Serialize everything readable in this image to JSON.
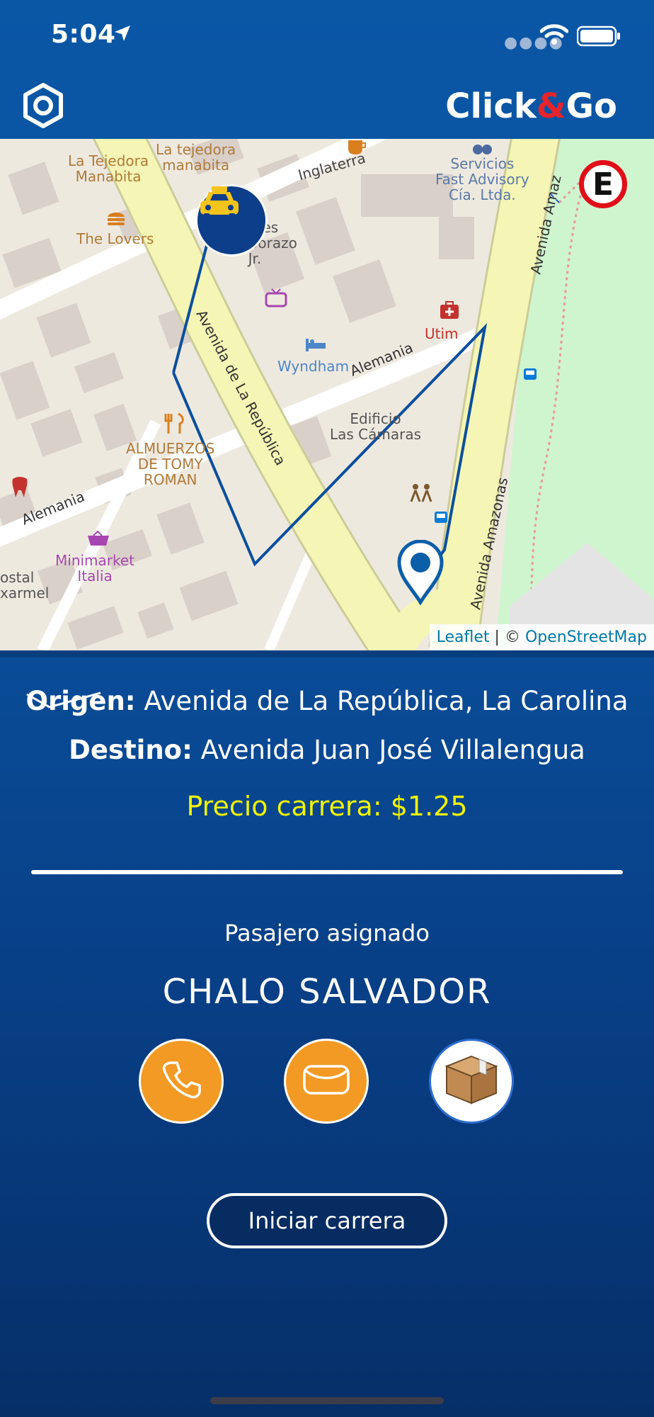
{
  "status_bar": {
    "time": "5:04"
  },
  "header": {
    "logo_prefix": "Click",
    "logo_amp": "&",
    "logo_suffix": "Go",
    "settings_icon": "hexagon-settings-icon"
  },
  "map": {
    "labels": {
      "tejedora": "La Tejedora\nManabita",
      "tejedora2": "La tejedora\nmanabita",
      "inglaterra": "Inglaterra",
      "servicios": "Servicios\nFast Advisory\nCía. Ltda.",
      "amazonas_top": "Avenida Amaz",
      "lovers": "The Lovers",
      "antenes": "tcenes\nChimborazo\nJr.",
      "utim": "Utim",
      "wyndham": "Wyndham",
      "alemania_mid": "Alemania",
      "republica": "Avenida de La República",
      "edificio": "Edificio\nLas Cámaras",
      "almuerzos": "ALMUERZOS\nDE TOMY\nROMAN",
      "alemania_left": "Alemania",
      "minimarket": "Minimarket\nItalia",
      "ostal": "ostal\nxarmel",
      "amazonas_bottom": "Avenida Amazonas",
      "parking": "E"
    },
    "attribution_leaflet": "Leaflet",
    "attribution_sep": " | © ",
    "attribution_osm": "OpenStreetMap"
  },
  "trip": {
    "origin_label": "Origen:",
    "origin_value": "Avenida de La República, La Carolina",
    "dest_label": "Destino:",
    "dest_value": "Avenida Juan José Villalengua",
    "price_label": "Precio carrera:",
    "price_value": "$1.25"
  },
  "passenger": {
    "label": "Pasajero asignado",
    "name": "CHALO SALVADOR"
  },
  "actions": {
    "call_icon": "phone-icon",
    "message_icon": "envelope-icon",
    "package_icon": "box-icon"
  },
  "start_button": "Iniciar carrera",
  "colors": {
    "accent_orange": "#f39a24",
    "price_yellow": "#f1f500",
    "background_blue": "#0a4f9c"
  }
}
